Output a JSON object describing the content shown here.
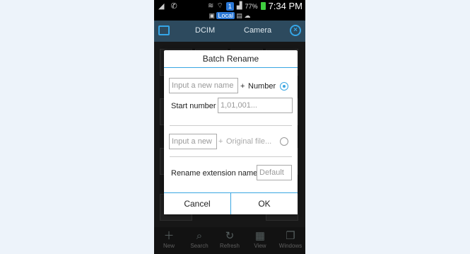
{
  "status_bar": {
    "battery_percent": "77%",
    "time": "7:34 PM",
    "notification_count": "1"
  },
  "notification": {
    "local_label": "Local"
  },
  "top_nav": {
    "tabs": [
      "DCIM",
      "Camera"
    ]
  },
  "toolbar": {
    "items": [
      {
        "label": "New",
        "icon": "plus-icon"
      },
      {
        "label": "Search",
        "icon": "search-icon"
      },
      {
        "label": "Refresh",
        "icon": "refresh-icon"
      },
      {
        "label": "View",
        "icon": "grid-view-icon"
      },
      {
        "label": "Windows",
        "icon": "windows-icon"
      }
    ]
  },
  "dialog": {
    "title": "Batch Rename",
    "option_number": {
      "placeholder": "Input a new name",
      "plus": "+",
      "label": "Number",
      "selected": true
    },
    "start_number": {
      "label": "Start number",
      "placeholder": "1,01,001..."
    },
    "option_original": {
      "placeholder": "Input a new name",
      "plus": "+",
      "label": "Original file...",
      "selected": false
    },
    "rename_extension": {
      "label": "Rename extension name",
      "placeholder": "Default"
    },
    "cancel_label": "Cancel",
    "ok_label": "OK"
  }
}
